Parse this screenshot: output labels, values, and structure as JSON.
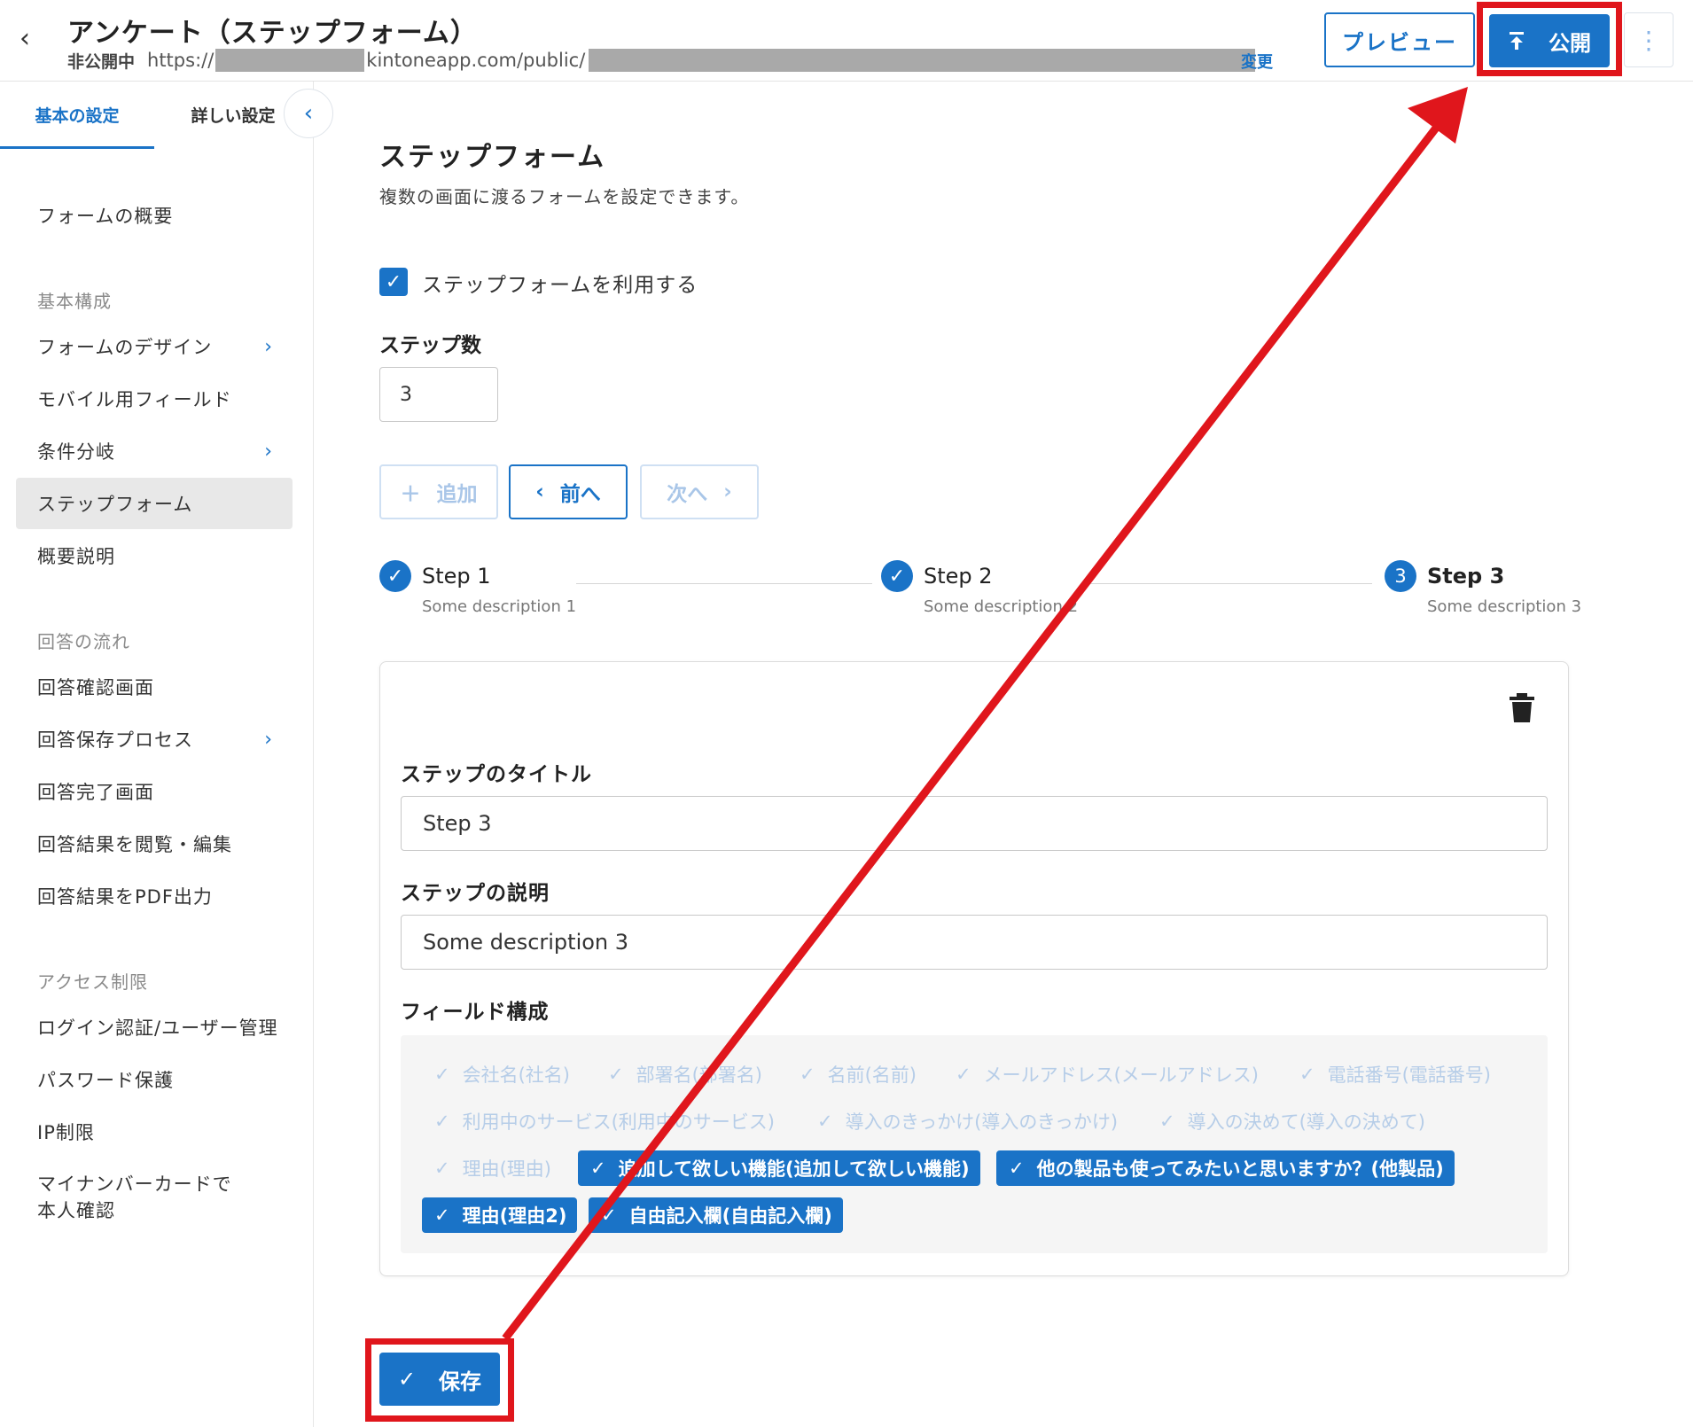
{
  "header": {
    "title": "アンケート（ステップフォーム）",
    "status": "非公開中",
    "url_prefix": "https://",
    "url_middle": "kintoneapp.com/public/",
    "change_label": "変更",
    "preview_label": "プレビュー",
    "publish_label": "公開"
  },
  "sidebar": {
    "tabs": [
      "基本の設定",
      "詳しい設定"
    ],
    "overview": "フォームの概要",
    "sections": [
      "基本構成",
      "回答の流れ",
      "アクセス制限"
    ],
    "items": [
      "フォームのデザイン",
      "モバイル用フィールド",
      "条件分岐",
      "ステップフォーム",
      "概要説明",
      "回答確認画面",
      "回答保存プロセス",
      "回答完了画面",
      "回答結果を閲覧・編集",
      "回答結果をPDF出力",
      "ログイン認証/ユーザー管理",
      "パスワード保護",
      "IP制限",
      "マイナンバーカードで本人確認"
    ]
  },
  "main": {
    "title": "ステップフォーム",
    "description": "複数の画面に渡るフォームを設定できます。",
    "use_checkbox_label": "ステップフォームを利用する",
    "use_checked": true,
    "step_count_label": "ステップ数",
    "step_count_value": "3",
    "buttons": {
      "add": "追加",
      "prev": "前へ",
      "next": "次へ"
    },
    "steps": [
      {
        "title": "Step 1",
        "description": "Some description 1",
        "state": "done"
      },
      {
        "title": "Step 2",
        "description": "Some description 2",
        "state": "done"
      },
      {
        "num": "3",
        "title": "Step 3",
        "description": "Some description 3",
        "state": "current"
      }
    ],
    "card": {
      "title_label": "ステップのタイトル",
      "title_value": "Step 3",
      "desc_label": "ステップの説明",
      "desc_value": "Some description 3",
      "fields_label": "フィールド構成",
      "fields": [
        {
          "label": "会社名(社名)",
          "selected": false
        },
        {
          "label": "部署名(部署名)",
          "selected": false
        },
        {
          "label": "名前(名前)",
          "selected": false
        },
        {
          "label": "メールアドレス(メールアドレス)",
          "selected": false
        },
        {
          "label": "電話番号(電話番号)",
          "selected": false
        },
        {
          "label": "利用中のサービス(利用中のサービス)",
          "selected": false
        },
        {
          "label": "導入のきっかけ(導入のきっかけ)",
          "selected": false
        },
        {
          "label": "導入の決めて(導入の決めて)",
          "selected": false
        },
        {
          "label": "理由(理由)",
          "selected": false
        },
        {
          "label": "追加して欲しい機能(追加して欲しい機能)",
          "selected": true
        },
        {
          "label": "他の製品も使ってみたいと思いますか？(他製品)",
          "selected": true
        },
        {
          "label": "理由(理由2)",
          "selected": true
        },
        {
          "label": "自由記入欄(自由記入欄)",
          "selected": true
        }
      ]
    },
    "save_label": "保存"
  },
  "colors": {
    "accent": "#1a73c7",
    "annotation": "#e0161c"
  }
}
